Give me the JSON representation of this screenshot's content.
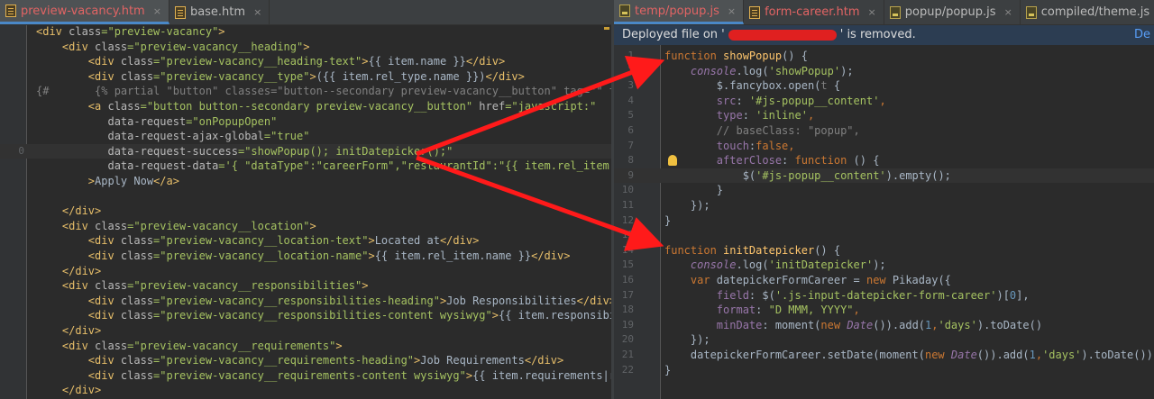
{
  "left": {
    "tabs": [
      {
        "label": "preview-vacancy.htm",
        "icon": "html-file-icon",
        "active": true,
        "color": "#e26464"
      },
      {
        "label": "base.htm",
        "icon": "html-file-icon",
        "active": false
      }
    ],
    "line_numbers": [
      "",
      "",
      "",
      "",
      "",
      "",
      "",
      "",
      "0",
      "",
      "",
      "",
      "",
      "",
      "",
      "",
      "",
      "",
      "",
      "",
      "",
      "",
      "",
      "",
      "",
      ""
    ],
    "lines": [
      [
        {
          "t": "<div ",
          "c": "tag"
        },
        {
          "t": "class",
          "c": "attr"
        },
        {
          "t": "=\"preview-vacancy\"",
          "c": "str"
        },
        {
          "t": ">",
          "c": "tag"
        }
      ],
      [
        {
          "t": "    <div ",
          "c": "tag"
        },
        {
          "t": "class",
          "c": "attr"
        },
        {
          "t": "=\"preview-vacancy__heading\"",
          "c": "str"
        },
        {
          "t": ">",
          "c": "tag"
        }
      ],
      [
        {
          "t": "        <div ",
          "c": "tag"
        },
        {
          "t": "class",
          "c": "attr"
        },
        {
          "t": "=\"preview-vacancy__heading-text\"",
          "c": "str"
        },
        {
          "t": ">",
          "c": "tag"
        },
        {
          "t": "{{ item.name }}",
          "c": "plain"
        },
        {
          "t": "</div>",
          "c": "tag"
        }
      ],
      [
        {
          "t": "        <div ",
          "c": "tag"
        },
        {
          "t": "class",
          "c": "attr"
        },
        {
          "t": "=\"preview-vacancy__type\"",
          "c": "str"
        },
        {
          "t": ">",
          "c": "tag"
        },
        {
          "t": "({{ item.rel_type.name }})",
          "c": "plain"
        },
        {
          "t": "</div>",
          "c": "tag"
        }
      ],
      [
        {
          "t": "{#       {% partial \"button\" classes=\"button--secondary preview-vacancy__button\" tag=\"\" type=\"\" t",
          "c": "cm"
        }
      ],
      [
        {
          "t": "        <a ",
          "c": "tag"
        },
        {
          "t": "class",
          "c": "attr"
        },
        {
          "t": "=\"button button--secondary preview-vacancy__button\" ",
          "c": "str"
        },
        {
          "t": "href",
          "c": "attr"
        },
        {
          "t": "=\"javascript:\"",
          "c": "str"
        }
      ],
      [
        {
          "t": "           data-request",
          "c": "attr"
        },
        {
          "t": "=\"onPopupOpen\"",
          "c": "str"
        }
      ],
      [
        {
          "t": "           data-request-ajax-global",
          "c": "attr"
        },
        {
          "t": "=\"true\"",
          "c": "str"
        }
      ],
      [
        {
          "t": "           data-request-success",
          "c": "attr"
        },
        {
          "t": "=\"showPopup(); initDatepicker();\"",
          "c": "str"
        }
      ],
      [
        {
          "t": "           data-request-data",
          "c": "attr"
        },
        {
          "t": "='{ \"dataType\":\"careerForm\",\"restaurantId\":\"{{ item.rel_item.id }}\",\"p",
          "c": "str"
        }
      ],
      [
        {
          "t": "        >",
          "c": "tag"
        },
        {
          "t": "Apply Now",
          "c": "plain"
        },
        {
          "t": "</a>",
          "c": "tag"
        }
      ],
      [],
      [
        {
          "t": "    </div>",
          "c": "tag"
        }
      ],
      [
        {
          "t": "    <div ",
          "c": "tag"
        },
        {
          "t": "class",
          "c": "attr"
        },
        {
          "t": "=\"preview-vacancy__location\"",
          "c": "str"
        },
        {
          "t": ">",
          "c": "tag"
        }
      ],
      [
        {
          "t": "        <div ",
          "c": "tag"
        },
        {
          "t": "class",
          "c": "attr"
        },
        {
          "t": "=\"preview-vacancy__location-text\"",
          "c": "str"
        },
        {
          "t": ">",
          "c": "tag"
        },
        {
          "t": "Located at",
          "c": "plain"
        },
        {
          "t": "</div>",
          "c": "tag"
        }
      ],
      [
        {
          "t": "        <div ",
          "c": "tag"
        },
        {
          "t": "class",
          "c": "attr"
        },
        {
          "t": "=\"preview-vacancy__location-name\"",
          "c": "str"
        },
        {
          "t": ">",
          "c": "tag"
        },
        {
          "t": "{{ item.rel_item.name }}",
          "c": "plain"
        },
        {
          "t": "</div>",
          "c": "tag"
        }
      ],
      [
        {
          "t": "    </div>",
          "c": "tag"
        }
      ],
      [
        {
          "t": "    <div ",
          "c": "tag"
        },
        {
          "t": "class",
          "c": "attr"
        },
        {
          "t": "=\"preview-vacancy__responsibilities\"",
          "c": "str"
        },
        {
          "t": ">",
          "c": "tag"
        }
      ],
      [
        {
          "t": "        <div ",
          "c": "tag"
        },
        {
          "t": "class",
          "c": "attr"
        },
        {
          "t": "=\"preview-vacancy__responsibilities-heading\"",
          "c": "str"
        },
        {
          "t": ">",
          "c": "tag"
        },
        {
          "t": "Job Responsibilities",
          "c": "plain"
        },
        {
          "t": "</div>",
          "c": "tag"
        }
      ],
      [
        {
          "t": "        <div ",
          "c": "tag"
        },
        {
          "t": "class",
          "c": "attr"
        },
        {
          "t": "=\"preview-vacancy__responsibilities-content wysiwyg\"",
          "c": "str"
        },
        {
          "t": ">",
          "c": "tag"
        },
        {
          "t": "{{ item.responsibilities|ra",
          "c": "plain"
        }
      ],
      [
        {
          "t": "    </div>",
          "c": "tag"
        }
      ],
      [
        {
          "t": "    <div ",
          "c": "tag"
        },
        {
          "t": "class",
          "c": "attr"
        },
        {
          "t": "=\"preview-vacancy__requirements\"",
          "c": "str"
        },
        {
          "t": ">",
          "c": "tag"
        }
      ],
      [
        {
          "t": "        <div ",
          "c": "tag"
        },
        {
          "t": "class",
          "c": "attr"
        },
        {
          "t": "=\"preview-vacancy__requirements-heading\"",
          "c": "str"
        },
        {
          "t": ">",
          "c": "tag"
        },
        {
          "t": "Job Requirements",
          "c": "plain"
        },
        {
          "t": "</div>",
          "c": "tag"
        }
      ],
      [
        {
          "t": "        <div ",
          "c": "tag"
        },
        {
          "t": "class",
          "c": "attr"
        },
        {
          "t": "=\"preview-vacancy__requirements-content wysiwyg\"",
          "c": "str"
        },
        {
          "t": ">",
          "c": "tag"
        },
        {
          "t": "{{ item.requirements|raw }}",
          "c": "plain"
        },
        {
          "t": "</di",
          "c": "tag"
        }
      ],
      [
        {
          "t": "    </div>",
          "c": "tag"
        }
      ]
    ]
  },
  "right": {
    "tabs": [
      {
        "label": "temp/popup.js",
        "icon": "js-file-icon",
        "active": true,
        "color": "#e26464"
      },
      {
        "label": "form-career.htm",
        "icon": "html-file-icon",
        "active": false,
        "color": "#e26464"
      },
      {
        "label": "popup/popup.js",
        "icon": "js-file-icon",
        "active": false
      },
      {
        "label": "compiled/theme.js",
        "icon": "js-file-icon",
        "active": false
      }
    ],
    "notification": {
      "prefix": "Deployed file on '",
      "suffix": "' is removed.",
      "link": "De"
    },
    "line_numbers": [
      "1",
      "2",
      "3",
      "4",
      "5",
      "6",
      "7",
      "8",
      "9",
      "10",
      "11",
      "12",
      "13",
      "14",
      "15",
      "16",
      "17",
      "18",
      "19",
      "20",
      "21",
      "22"
    ],
    "lines": [
      [
        {
          "t": "function ",
          "c": "kw"
        },
        {
          "t": "showPopup",
          "c": "fn"
        },
        {
          "t": "() {",
          "c": "plain"
        }
      ],
      [
        {
          "t": "    console",
          "c": "prop it"
        },
        {
          "t": ".log(",
          "c": "plain"
        },
        {
          "t": "'showPopup'",
          "c": "str"
        },
        {
          "t": ");",
          "c": "plain"
        }
      ],
      [
        {
          "t": "        $.fancybox.open(",
          "c": "plain"
        },
        {
          "t": "t",
          "c": "cm"
        },
        {
          "t": " {",
          "c": "plain"
        }
      ],
      [
        {
          "t": "        src",
          "c": "prop"
        },
        {
          "t": ": ",
          "c": "plain"
        },
        {
          "t": "'#js-popup__content'",
          "c": "str"
        },
        {
          "t": ",",
          "c": "kw"
        }
      ],
      [
        {
          "t": "        type",
          "c": "prop"
        },
        {
          "t": ": ",
          "c": "plain"
        },
        {
          "t": "'inline'",
          "c": "str"
        },
        {
          "t": ",",
          "c": "kw"
        }
      ],
      [
        {
          "t": "        // baseClass: \"popup\",",
          "c": "cm"
        }
      ],
      [
        {
          "t": "        touch",
          "c": "prop"
        },
        {
          "t": ":",
          "c": "plain"
        },
        {
          "t": "false",
          "c": "kw"
        },
        {
          "t": ",",
          "c": "kw"
        }
      ],
      [
        {
          "t": "        afterClose",
          "c": "prop"
        },
        {
          "t": ": ",
          "c": "plain"
        },
        {
          "t": "function ",
          "c": "kw"
        },
        {
          "t": "() {",
          "c": "plain"
        }
      ],
      [
        {
          "t": "            $(",
          "c": "plain"
        },
        {
          "t": "'#js-popup__content'",
          "c": "str"
        },
        {
          "t": ").empty();",
          "c": "plain"
        }
      ],
      [
        {
          "t": "        }",
          "c": "plain"
        }
      ],
      [
        {
          "t": "    });",
          "c": "plain"
        }
      ],
      [
        {
          "t": "}",
          "c": "plain"
        }
      ],
      [],
      [
        {
          "t": "function ",
          "c": "kw"
        },
        {
          "t": "initDatepicker",
          "c": "fn"
        },
        {
          "t": "() {",
          "c": "plain"
        }
      ],
      [
        {
          "t": "    console",
          "c": "prop it"
        },
        {
          "t": ".log(",
          "c": "plain"
        },
        {
          "t": "'initDatepicker'",
          "c": "str"
        },
        {
          "t": ");",
          "c": "plain"
        }
      ],
      [
        {
          "t": "    var ",
          "c": "kw"
        },
        {
          "t": "datepickerFormCareer = ",
          "c": "plain"
        },
        {
          "t": "new ",
          "c": "kw"
        },
        {
          "t": "Pikaday({",
          "c": "plain"
        }
      ],
      [
        {
          "t": "        field",
          "c": "prop"
        },
        {
          "t": ": $(",
          "c": "plain"
        },
        {
          "t": "'.js-input-datepicker-form-career'",
          "c": "str"
        },
        {
          "t": ")[",
          "c": "plain"
        },
        {
          "t": "0",
          "c": "num"
        },
        {
          "t": "],",
          "c": "plain"
        }
      ],
      [
        {
          "t": "        format",
          "c": "prop"
        },
        {
          "t": ": ",
          "c": "plain"
        },
        {
          "t": "\"D MMM, YYYY\"",
          "c": "str"
        },
        {
          "t": ",",
          "c": "kw"
        }
      ],
      [
        {
          "t": "        minDate",
          "c": "prop"
        },
        {
          "t": ": moment(",
          "c": "plain"
        },
        {
          "t": "new ",
          "c": "kw"
        },
        {
          "t": "Date",
          "c": "prop it"
        },
        {
          "t": "()).add(",
          "c": "plain"
        },
        {
          "t": "1",
          "c": "num"
        },
        {
          "t": ",",
          "c": "kw"
        },
        {
          "t": "'days'",
          "c": "str"
        },
        {
          "t": ").toDate()",
          "c": "plain"
        }
      ],
      [
        {
          "t": "    });",
          "c": "plain"
        }
      ],
      [
        {
          "t": "    datepickerFormCareer.setDate(moment(",
          "c": "plain"
        },
        {
          "t": "new ",
          "c": "kw"
        },
        {
          "t": "Date",
          "c": "prop it"
        },
        {
          "t": "()).add(",
          "c": "plain"
        },
        {
          "t": "1",
          "c": "num"
        },
        {
          "t": ",",
          "c": "kw"
        },
        {
          "t": "'days'",
          "c": "str"
        },
        {
          "t": ").toDate());",
          "c": "plain"
        }
      ],
      [
        {
          "t": "}",
          "c": "plain"
        }
      ]
    ]
  },
  "colors": {
    "annotation_arrow": "#ff1a1a",
    "accent": "#4a88c7"
  }
}
